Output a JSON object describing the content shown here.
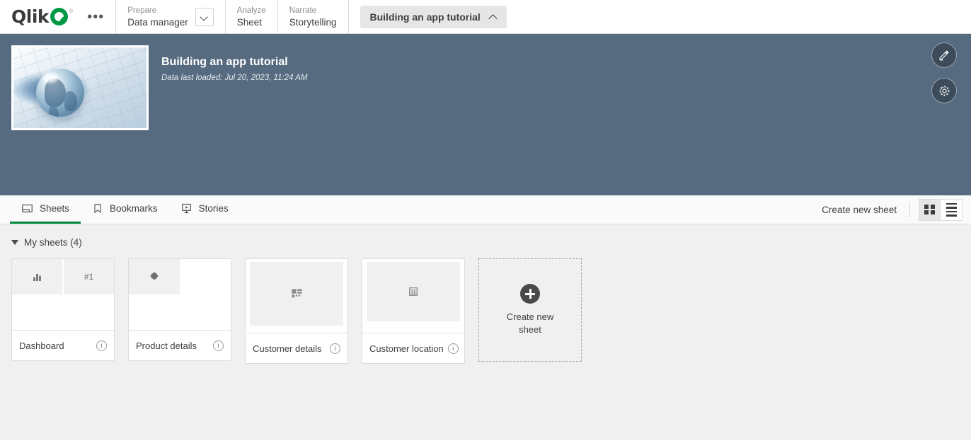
{
  "topnav": {
    "logo_word": "Qlik",
    "logo_tm": "®",
    "overflow_label": "•••",
    "groups": [
      {
        "kicker": "Prepare",
        "title": "Data manager",
        "has_caret": true
      },
      {
        "kicker": "Analyze",
        "title": "Sheet",
        "has_caret": false
      },
      {
        "kicker": "Narrate",
        "title": "Storytelling",
        "has_caret": false
      }
    ],
    "app_pill_label": "Building an app tutorial"
  },
  "banner": {
    "title": "Building an app tutorial",
    "subtitle": "Data last loaded: Jul 20, 2023, 11:24 AM",
    "background_color": "#566b80",
    "actions": [
      {
        "name": "edit-app-button",
        "icon": "pencil-icon"
      },
      {
        "name": "app-settings-button",
        "icon": "gear-icon"
      }
    ]
  },
  "tabbar": {
    "tabs": [
      {
        "label": "Sheets",
        "icon": "sheet-icon",
        "active": true
      },
      {
        "label": "Bookmarks",
        "icon": "bookmark-icon",
        "active": false
      },
      {
        "label": "Stories",
        "icon": "story-icon",
        "active": false
      }
    ],
    "create_new_sheet": "Create new sheet",
    "view_grid": "grid-view-icon",
    "view_list": "list-view-icon",
    "active_view": "grid",
    "accent_color": "#00873d"
  },
  "content": {
    "section_title": "My sheets (4)",
    "sheets": [
      {
        "name": "Dashboard",
        "thumb": "split",
        "icons": [
          "bar-chart-icon",
          "#1"
        ]
      },
      {
        "name": "Product details",
        "thumb": "single",
        "icons": [
          "puzzle-icon"
        ]
      },
      {
        "name": "Customer details",
        "thumb": "wide",
        "icons": [
          "filter-pane-icon"
        ]
      },
      {
        "name": "Customer location",
        "thumb": "wide2",
        "icons": [
          "table-icon"
        ]
      }
    ],
    "create_card": {
      "label_line1": "Create new",
      "label_line2": "sheet",
      "icon": "plus-circle-icon"
    }
  }
}
